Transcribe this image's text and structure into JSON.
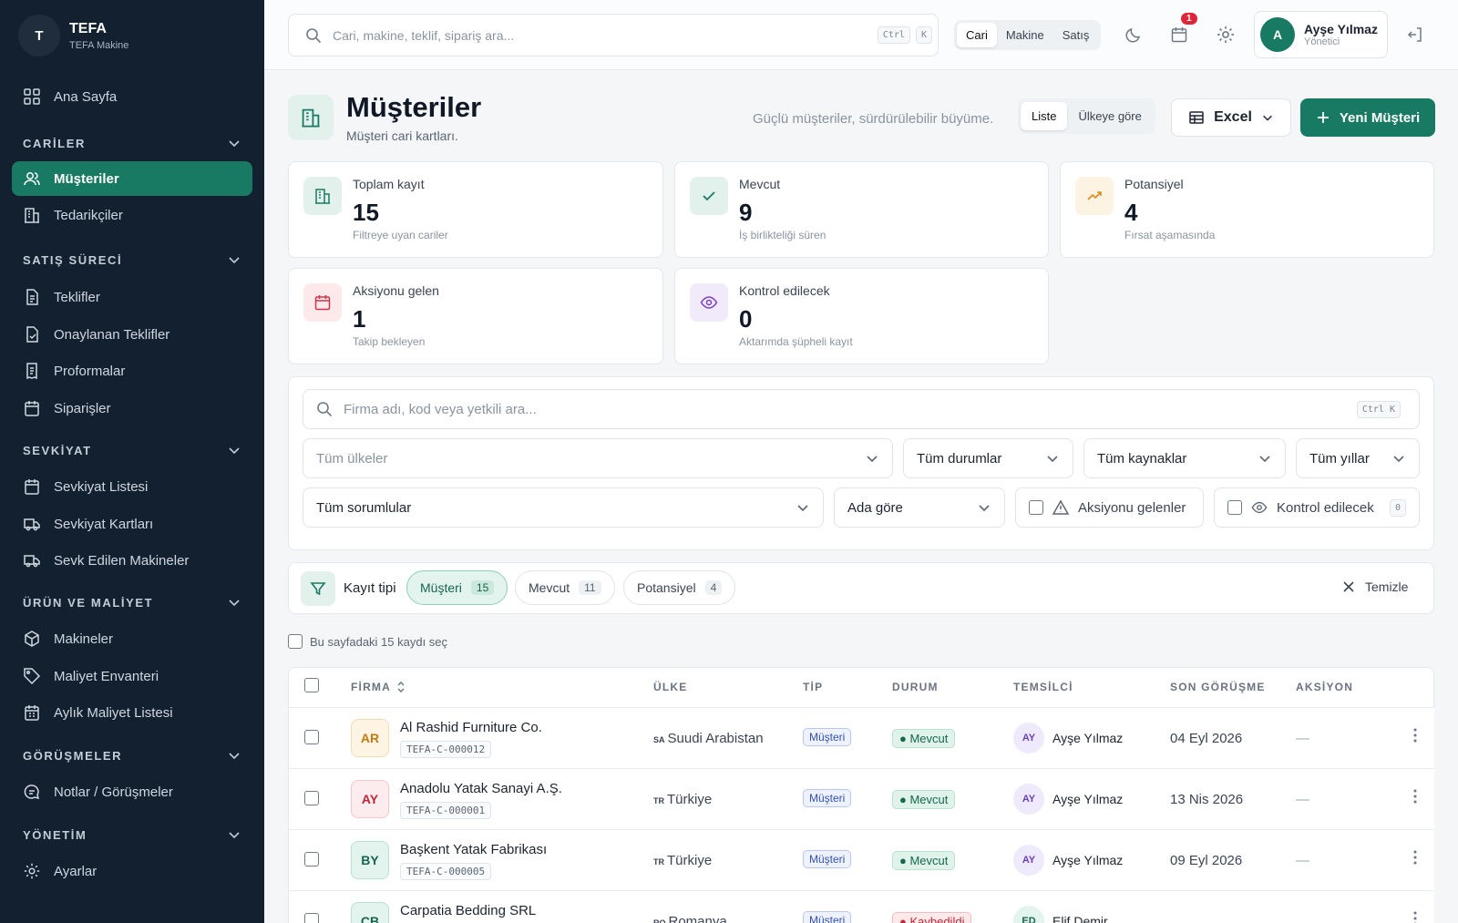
{
  "sidebar": {
    "brand": {
      "avatar": "T",
      "title": "TEFA",
      "subtitle": "TEFA Makine"
    },
    "home": "Ana Sayfa",
    "sections": [
      {
        "title": "CARİLER",
        "items": [
          "Müşteriler",
          "Tedarikçiler"
        ]
      },
      {
        "title": "SATIŞ SÜRECİ",
        "items": [
          "Teklifler",
          "Onaylanan Teklifler",
          "Proformalar",
          "Siparişler"
        ]
      },
      {
        "title": "SEVKİYAT",
        "items": [
          "Sevkiyat Listesi",
          "Sevkiyat Kartları",
          "Sevk Edilen Makineler"
        ]
      },
      {
        "title": "ÜRÜN VE MALİYET",
        "items": [
          "Makineler",
          "Maliyet Envanteri",
          "Aylık Maliyet Listesi"
        ]
      },
      {
        "title": "GÖRÜŞMELER",
        "items": [
          "Notlar / Görüşmeler"
        ]
      },
      {
        "title": "YÖNETİM",
        "items": [
          "Ayarlar"
        ]
      }
    ],
    "active_item": "Müşteriler"
  },
  "topbar": {
    "search_placeholder": "Cari, makine, teklif, sipariş ara...",
    "kbd_ctrl": "Ctrl",
    "kbd_k": "K",
    "scope_tabs": [
      "Cari",
      "Makine",
      "Satış"
    ],
    "notification_count": "1",
    "user": {
      "initial": "A",
      "name": "Ayşe Yılmaz",
      "role": "Yönetici"
    }
  },
  "page": {
    "title": "Müşteriler",
    "subtitle": "Müşteri cari kartları.",
    "tagline": "Güçlü müşteriler, sürdürülebilir büyüme.",
    "view_tabs": [
      "Liste",
      "Ülkeye göre"
    ],
    "excel_label": "Excel",
    "new_button": "Yeni Müşteri"
  },
  "stats": [
    {
      "label": "Toplam kayıt",
      "value": "15",
      "desc": "Filtreye uyan cariler",
      "icon": "building-icon",
      "color": "#197a63"
    },
    {
      "label": "Mevcut",
      "value": "9",
      "desc": "İş birlikteliği süren",
      "icon": "check-icon",
      "color": "#197a63"
    },
    {
      "label": "Potansiyel",
      "value": "4",
      "desc": "Fırsat aşamasında",
      "icon": "trending-up-icon",
      "color": "#e08a1e"
    },
    {
      "label": "Aksiyonu gelen",
      "value": "1",
      "desc": "Takip bekleyen",
      "icon": "calendar-icon",
      "color": "#d0344a"
    },
    {
      "label": "Kontrol edilecek",
      "value": "0",
      "desc": "Aktarımda şüpheli kayıt",
      "icon": "eye-icon",
      "color": "#7a3fc8"
    }
  ],
  "filters": {
    "search_placeholder": "Firma adı, kod veya yetkili ara...",
    "search_kbd": "Ctrl K",
    "country": "Tüm ülkeler",
    "status": "Tüm durumlar",
    "source": "Tüm kaynaklar",
    "year": "Tüm yıllar",
    "owner": "Tüm sorumlular",
    "sort": "Ada göre",
    "action_due": "Aksiyonu gelenler",
    "to_check": "Kontrol edilecek",
    "to_check_count": "0"
  },
  "record_type": {
    "label": "Kayıt tipi",
    "chips": [
      {
        "label": "Müşteri",
        "count": "15",
        "active": true
      },
      {
        "label": "Mevcut",
        "count": "11",
        "active": false
      },
      {
        "label": "Potansiyel",
        "count": "4",
        "active": false
      }
    ],
    "clear": "Temizle"
  },
  "select_page": "Bu sayfadaki 15 kaydı seç",
  "table": {
    "columns": [
      "FİRMA",
      "ÜLKE",
      "TİP",
      "DURUM",
      "TEMSİLCİ",
      "SON GÖRÜŞME",
      "AKSİYON"
    ],
    "rows": [
      {
        "initials": "AR",
        "firm": "Al Rashid Furniture Co.",
        "code": "TEFA-C-000012",
        "cc": "SA",
        "country": "Suudi Arabistan",
        "type": "Müşteri",
        "status": "Mevcut",
        "rep_initials": "AY",
        "rep": "Ayşe Yılmaz",
        "last_meeting": "04 Eyl 2026",
        "action": "—",
        "tone": "amber"
      },
      {
        "initials": "AY",
        "firm": "Anadolu Yatak Sanayi A.Ş.",
        "code": "TEFA-C-000001",
        "cc": "TR",
        "country": "Türkiye",
        "type": "Müşteri",
        "status": "Mevcut",
        "rep_initials": "AY",
        "rep": "Ayşe Yılmaz",
        "last_meeting": "13 Nis 2026",
        "action": "—",
        "tone": "red"
      },
      {
        "initials": "BY",
        "firm": "Başkent Yatak Fabrikası",
        "code": "TEFA-C-000005",
        "cc": "TR",
        "country": "Türkiye",
        "type": "Müşteri",
        "status": "Mevcut",
        "rep_initials": "AY",
        "rep": "Ayşe Yılmaz",
        "last_meeting": "09 Eyl 2026",
        "action": "—",
        "tone": "teal"
      },
      {
        "initials": "CB",
        "firm": "Carpatia Bedding SRL",
        "code": "",
        "cc": "RO",
        "country": "Romanya",
        "type": "Müşteri",
        "status": "Kaybedildi",
        "rep_initials": "ED",
        "rep": "Elif Demir",
        "last_meeting": "",
        "action": "",
        "tone": "teal"
      }
    ]
  },
  "colors": {
    "sidebar": "#13202f",
    "accent": "#197a63",
    "badge": "#e0243a"
  }
}
